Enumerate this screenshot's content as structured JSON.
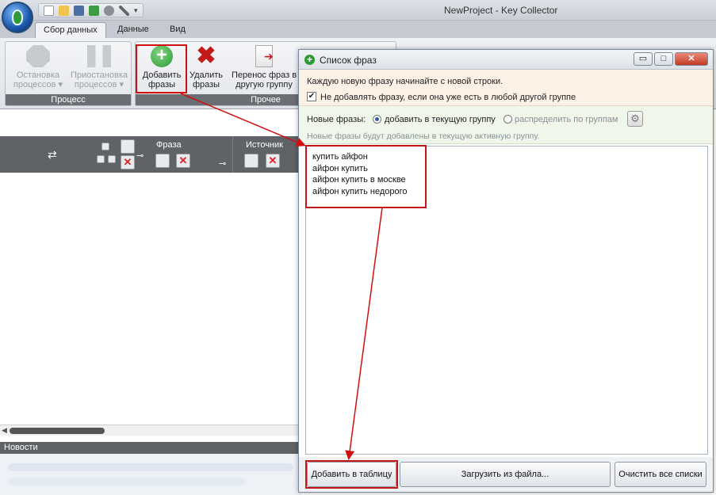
{
  "window": {
    "title": "NewProject - Key Collector"
  },
  "tabs": [
    {
      "label": "Сбор данных"
    },
    {
      "label": "Данные"
    },
    {
      "label": "Вид"
    }
  ],
  "ribbon": {
    "process_group": {
      "label": "Процесс"
    },
    "other_group": {
      "label": "Прочее"
    },
    "stop": {
      "line1": "Остановка",
      "line2": "процессов ▾"
    },
    "pause": {
      "line1": "Приостановка",
      "line2": "процессов ▾"
    },
    "add": {
      "line1": "Добавить",
      "line2": "фразы"
    },
    "delete": {
      "line1": "Удалить",
      "line2": "фразы"
    },
    "move": {
      "line1": "Перенос фраз в",
      "line2": "другую группу"
    }
  },
  "grid": {
    "col_phrase": "Фраза",
    "col_source": "Источник"
  },
  "news": {
    "label": "Новости"
  },
  "dialog": {
    "title": "Список фраз",
    "window_buttons": {
      "minimize": "▭",
      "maximize": "□",
      "close": "✕"
    },
    "instruction": "Каждую новую фразу начинайте с новой строки.",
    "dedupe_label": "Не добавлять фразу, если она уже есть в любой другой группе",
    "dedupe_checked": "✔",
    "new_label": "Новые фразы:",
    "option_current": "добавить в текущую группу",
    "option_distribute": "распределить по группам",
    "hint": "Новые фразы будут добавлены в текущую активную группу.",
    "phrases": "купить айфон\nайфон купить\nайфон купить в москве\nайфон купить недорого",
    "btn_add": "Добавить в таблицу",
    "btn_load": "Загрузить из файла...",
    "btn_clear": "Очистить все списки"
  },
  "colors": {
    "highlight": "#d01010",
    "accent_green": "#2f9b38",
    "header_dark": "#5f6266"
  },
  "icons": [
    "app-orb-icon",
    "new-file-icon",
    "open-folder-icon",
    "save-icon",
    "export-icon",
    "settings-icon",
    "wrench-icon",
    "stop-icon",
    "pause-icon",
    "add-icon",
    "delete-icon",
    "move-icon",
    "gear-icon"
  ]
}
